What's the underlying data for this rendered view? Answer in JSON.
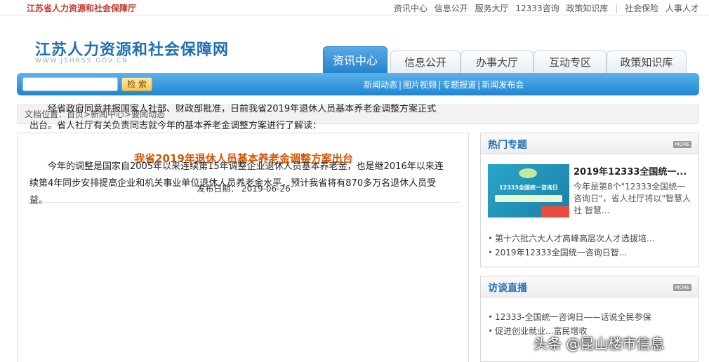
{
  "topbar": {
    "site_name": "江苏省人力资源和社会保障厅",
    "links": [
      "资讯中心",
      "信息公开",
      "服务大厅",
      "12333咨询",
      "政策知识库",
      "社会保险",
      "人事人才"
    ]
  },
  "header": {
    "logo_title": "江苏人力资源和社会保障网",
    "logo_url": "WWW.JSHRSS.GOV.CN"
  },
  "tabs": [
    "资讯中心",
    "信息公开",
    "办事大厅",
    "互动专区",
    "政策知识库"
  ],
  "search": {
    "button_label": "检 索",
    "value": ""
  },
  "subnav": [
    "新闻动态",
    "图片视频",
    "专题报道",
    "新闻发布会"
  ],
  "breadcrumb": "文档位置：首页>新闻中心>要闻动态",
  "article": {
    "title": "我省2019年退休人员基本养老金调整方案出台",
    "date": "发布日期： 2019-06-26",
    "paragraphs": [
      "经省政府同意并报国家人社部、财政部批准，日前我省2019年退休人员基本养老金调整方案正式出台。省人社厅有关负责同志就今年的基本养老金调整方案进行了解读：",
      "今年的调整是国家自2005年以来连续第15年调整企业退休人员基本养老金，也是继2016年以来连续第4年同步安排提高企业和机关事业单位退休人员养老金水平，预计我省将有870多万名退休人员受益。"
    ]
  },
  "hot_topics": {
    "title": "热门专题",
    "more": "MORE",
    "thumb_text": "12333全国统一咨询日",
    "featured_title": "2019年12333全国统一...",
    "featured_desc": "今年是第8个\"12333全国统一咨询日\"，省人社厅将以\"智慧人社 智慧...",
    "items": [
      "第十六批六大人才高峰高层次人才选拔培...",
      "2019年12333全国统一咨询日智..."
    ]
  },
  "interviews": {
    "title": "访谈直播",
    "more": "MORE",
    "items": [
      "12333-全国统一咨询日——话说全民参保",
      "促进创业就业...富民增收"
    ]
  },
  "watermark": "头条 @昆山楼市信息"
}
